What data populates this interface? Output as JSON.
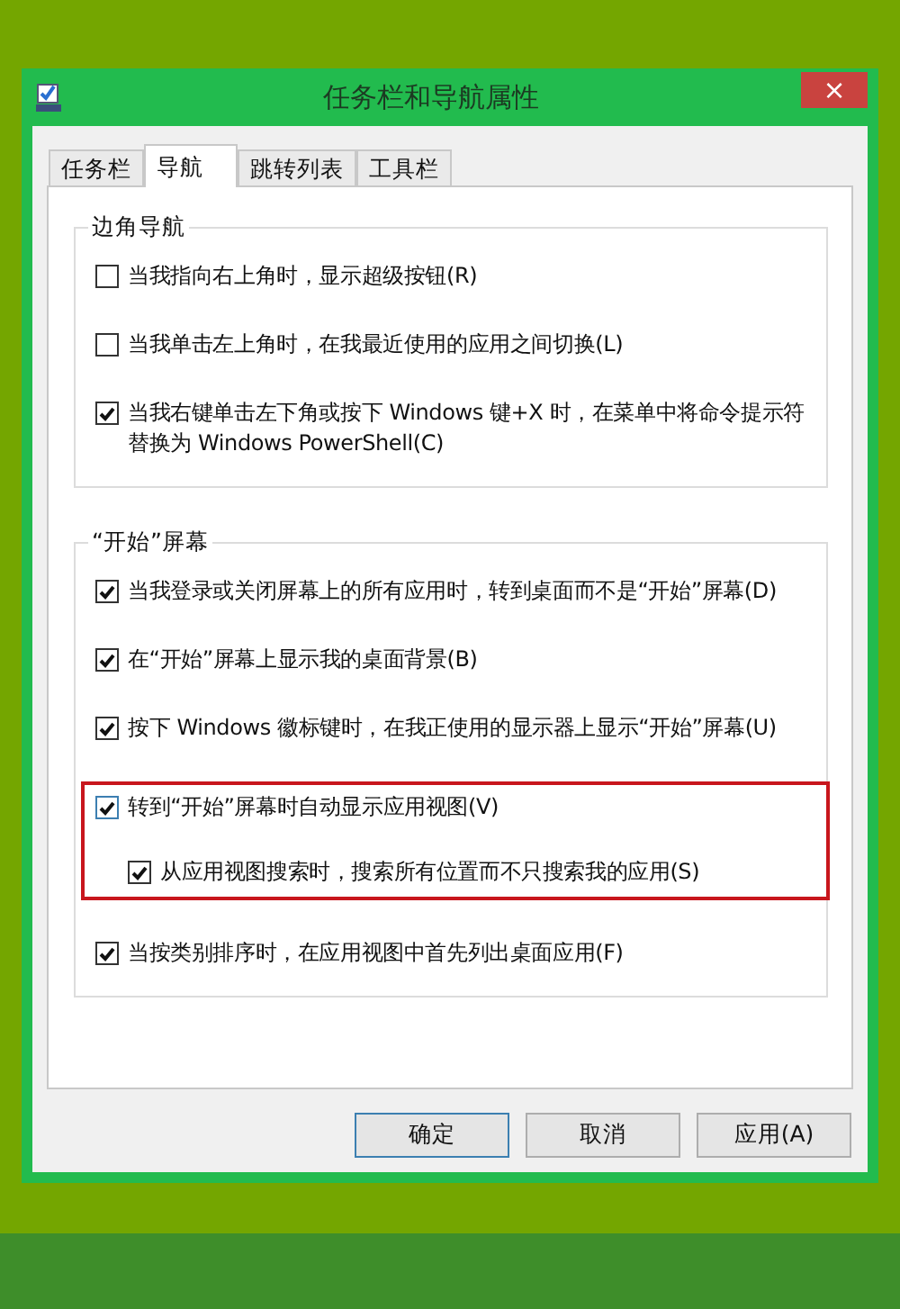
{
  "window": {
    "title": "任务栏和导航属性",
    "close": "×"
  },
  "tabs": [
    {
      "label": "任务栏",
      "selected": false
    },
    {
      "label": "导航",
      "selected": true
    },
    {
      "label": "跳转列表",
      "selected": false
    },
    {
      "label": "工具栏",
      "selected": false
    }
  ],
  "groups": [
    {
      "title": "边角导航",
      "items": [
        {
          "label": "当我指向右上角时，显示超级按钮(R)",
          "checked": false
        },
        {
          "label": "当我单击左上角时，在我最近使用的应用之间切换(L)",
          "checked": false
        },
        {
          "label": "当我右键单击左下角或按下 Windows 键+X 时，在菜单中将命令提示符替换为 Windows PowerShell(C)",
          "checked": true
        }
      ]
    },
    {
      "title": "“开始”屏幕",
      "items": [
        {
          "label": "当我登录或关闭屏幕上的所有应用时，转到桌面而不是“开始”屏幕(D)",
          "checked": true
        },
        {
          "label": "在“开始”屏幕上显示我的桌面背景(B)",
          "checked": true
        },
        {
          "label": "按下 Windows 徽标键时，在我正使用的显示器上显示“开始”屏幕(U)",
          "checked": true
        },
        {
          "label": "转到“开始”屏幕时自动显示应用视图(V)",
          "checked": true,
          "highlighted": true,
          "children": [
            {
              "label": "从应用视图搜索时，搜索所有位置而不只搜索我的应用(S)",
              "checked": true
            }
          ]
        },
        {
          "label": "当按类别排序时，在应用视图中首先列出桌面应用(F)",
          "checked": true
        }
      ]
    }
  ],
  "buttons": [
    {
      "label": "确定",
      "default": true
    },
    {
      "label": "取消",
      "default": false
    },
    {
      "label": "应用(A)",
      "default": false
    }
  ]
}
